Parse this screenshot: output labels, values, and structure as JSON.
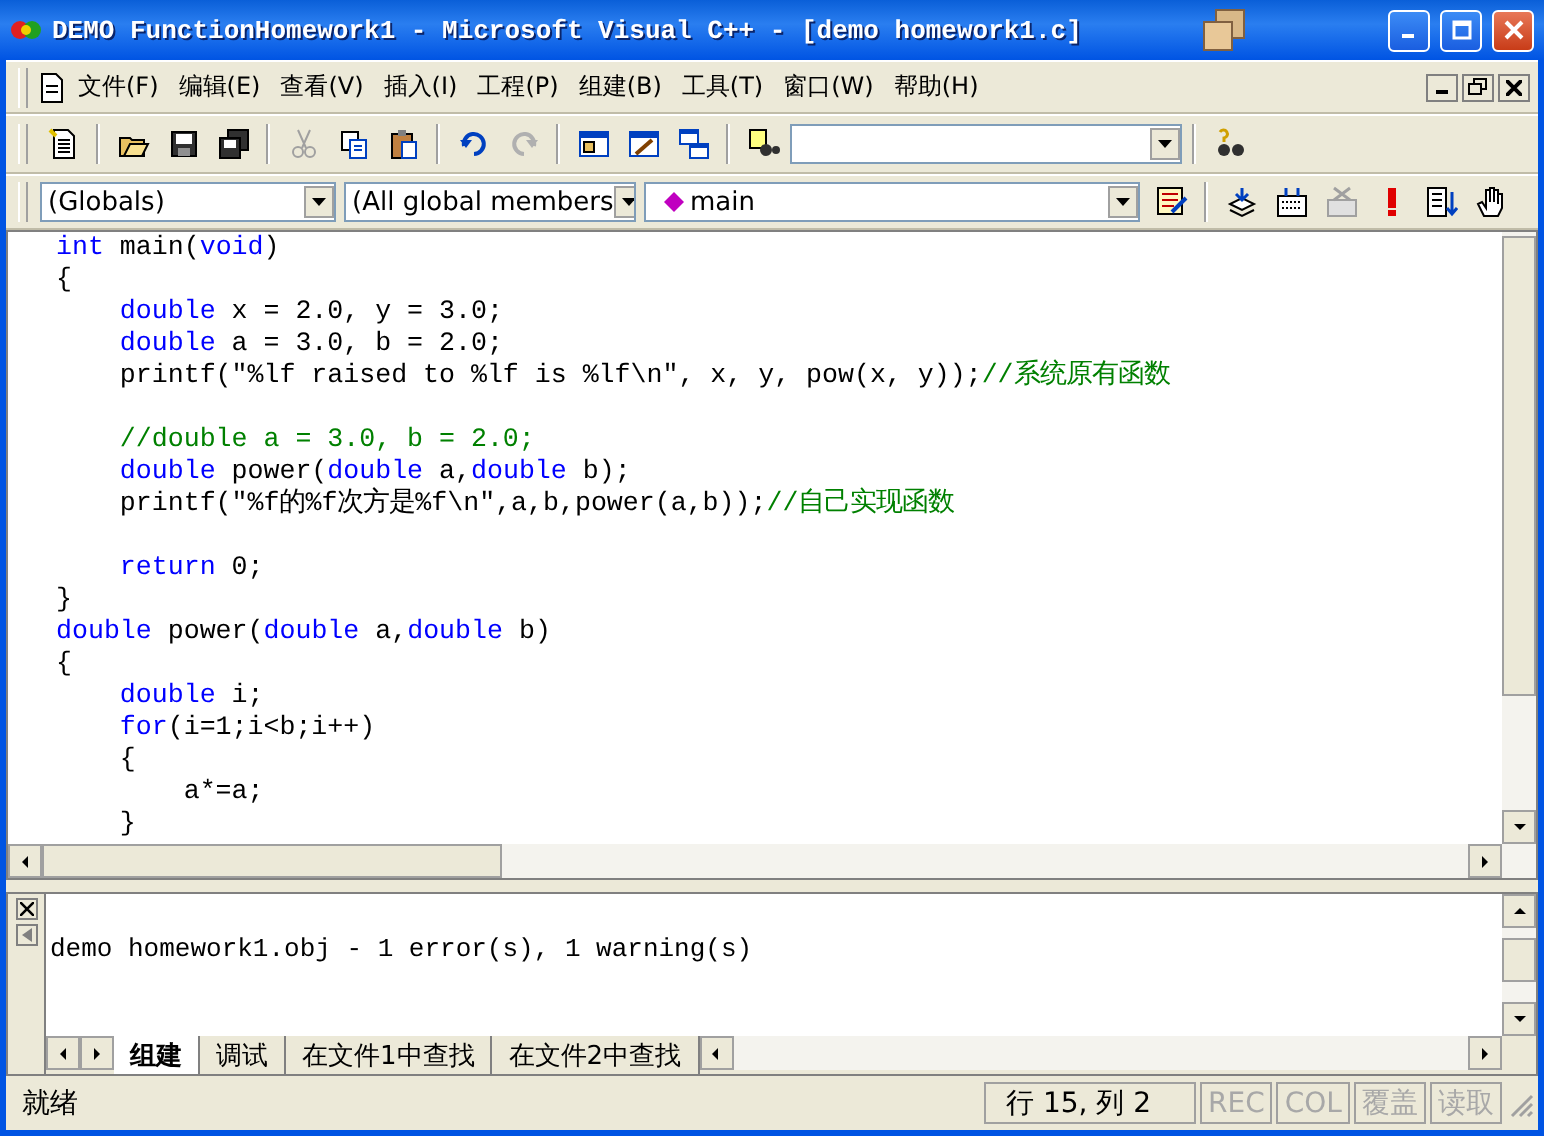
{
  "window": {
    "title": "DEMO FunctionHomework1 - Microsoft Visual C++ - [demo homework1.c]"
  },
  "menu": [
    "文件(F)",
    "编辑(E)",
    "查看(V)",
    "插入(I)",
    "工程(P)",
    "组建(B)",
    "工具(T)",
    "窗口(W)",
    "帮助(H)"
  ],
  "toolbar": [
    {
      "kind": "new",
      "disabled": false
    },
    {
      "kind": "separator"
    },
    {
      "kind": "open",
      "disabled": false
    },
    {
      "kind": "save",
      "disabled": false
    },
    {
      "kind": "save-all",
      "disabled": false
    },
    {
      "kind": "separator"
    },
    {
      "kind": "cut",
      "disabled": true
    },
    {
      "kind": "copy",
      "disabled": false
    },
    {
      "kind": "paste",
      "disabled": false
    },
    {
      "kind": "separator"
    },
    {
      "kind": "undo",
      "disabled": false
    },
    {
      "kind": "redo",
      "disabled": true
    },
    {
      "kind": "separator"
    },
    {
      "kind": "workspace",
      "disabled": false
    },
    {
      "kind": "output",
      "disabled": false
    },
    {
      "kind": "windows",
      "disabled": false
    },
    {
      "kind": "separator"
    },
    {
      "kind": "find-in-files",
      "disabled": false
    },
    {
      "kind": "combo"
    },
    {
      "kind": "separator"
    },
    {
      "kind": "find",
      "disabled": false
    }
  ],
  "wizard_bar": {
    "combos": [
      {
        "value": "(Globals)"
      },
      {
        "value": "(All global members"
      },
      {
        "value": "main"
      }
    ],
    "tools": [
      {
        "kind": "wizard",
        "disabled": false
      },
      {
        "kind": "separator"
      },
      {
        "kind": "compile",
        "disabled": false
      },
      {
        "kind": "build",
        "disabled": false
      },
      {
        "kind": "stop",
        "disabled": true
      },
      {
        "kind": "execute",
        "disabled": false
      },
      {
        "kind": "breakpoint",
        "disabled": false
      },
      {
        "kind": "hand",
        "disabled": false
      }
    ]
  },
  "editor": {
    "lines": [
      {
        "tokens": [
          {
            "kind": "keyword",
            "text": "int"
          },
          {
            "kind": "plain",
            "text": " main("
          },
          {
            "kind": "keyword",
            "text": "void"
          },
          {
            "kind": "plain",
            "text": ")"
          }
        ]
      },
      {
        "tokens": [
          {
            "kind": "plain",
            "text": "{"
          }
        ]
      },
      {
        "tokens": [
          {
            "kind": "keyword",
            "text": "    double"
          },
          {
            "kind": "plain",
            "text": " x = 2.0, y = 3.0;"
          }
        ]
      },
      {
        "tokens": [
          {
            "kind": "keyword",
            "text": "    double"
          },
          {
            "kind": "plain",
            "text": " a = 3.0, b = 2.0;"
          }
        ]
      },
      {
        "tokens": [
          {
            "kind": "plain",
            "text": "    printf(\"%lf raised to %lf is %lf\\n\", x, y, pow(x, y));"
          },
          {
            "kind": "comment",
            "text": "//系统原有函数"
          }
        ]
      },
      {
        "blank": true
      },
      {
        "tokens": [
          {
            "kind": "comment",
            "text": "    //double a = 3.0, b = 2.0;"
          }
        ]
      },
      {
        "tokens": [
          {
            "kind": "keyword",
            "text": "    double"
          },
          {
            "kind": "plain",
            "text": " power("
          },
          {
            "kind": "keyword",
            "text": "double"
          },
          {
            "kind": "plain",
            "text": " a,"
          },
          {
            "kind": "keyword",
            "text": "double"
          },
          {
            "kind": "plain",
            "text": " b);"
          }
        ]
      },
      {
        "tokens": [
          {
            "kind": "plain",
            "text": "    printf(\"%f的%f次方是%f\\n\",a,b,power(a,b));"
          },
          {
            "kind": "comment",
            "text": "//自己实现函数"
          }
        ]
      },
      {
        "blank": true
      },
      {
        "tokens": [
          {
            "kind": "keyword",
            "text": "    return"
          },
          {
            "kind": "plain",
            "text": " 0;"
          }
        ]
      },
      {
        "tokens": [
          {
            "kind": "plain",
            "text": "}"
          }
        ]
      },
      {
        "tokens": [
          {
            "kind": "keyword",
            "text": "double"
          },
          {
            "kind": "plain",
            "text": " power("
          },
          {
            "kind": "keyword",
            "text": "double"
          },
          {
            "kind": "plain",
            "text": " a,"
          },
          {
            "kind": "keyword",
            "text": "double"
          },
          {
            "kind": "plain",
            "text": " b)"
          }
        ]
      },
      {
        "tokens": [
          {
            "kind": "plain",
            "text": "{"
          }
        ]
      },
      {
        "tokens": [
          {
            "kind": "keyword",
            "text": "    double"
          },
          {
            "kind": "plain",
            "text": " i;"
          }
        ]
      },
      {
        "tokens": [
          {
            "kind": "keyword",
            "text": "    for"
          },
          {
            "kind": "plain",
            "text": "(i=1;i<b;i++)"
          }
        ]
      },
      {
        "tokens": [
          {
            "kind": "plain",
            "text": "    {"
          }
        ]
      },
      {
        "tokens": [
          {
            "kind": "plain",
            "text": "        a*=a;"
          }
        ]
      },
      {
        "tokens": [
          {
            "kind": "plain",
            "text": "    }"
          }
        ]
      }
    ]
  },
  "output": {
    "text": "demo homework1.obj - 1 error(s), 1 warning(s)",
    "tabs": [
      {
        "label": "组建",
        "selected": true
      },
      {
        "label": "调试",
        "selected": false
      },
      {
        "label": "在文件1中查找",
        "selected": false
      },
      {
        "label": "在文件2中查找",
        "selected": false
      }
    ]
  },
  "status_bar": {
    "message": "就绪",
    "panels": [
      {
        "text": "行 15, 列 2",
        "disabled": false
      },
      {
        "text": "REC",
        "disabled": true
      },
      {
        "text": "COL",
        "disabled": true
      },
      {
        "text": "覆盖",
        "disabled": true
      },
      {
        "text": "读取",
        "disabled": true
      }
    ]
  }
}
